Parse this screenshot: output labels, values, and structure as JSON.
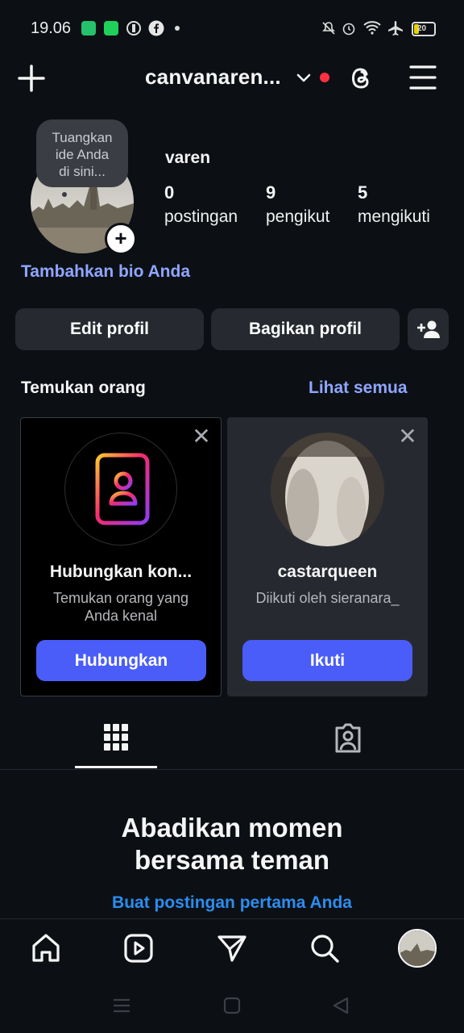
{
  "status_bar": {
    "time": "19.06",
    "battery": "20"
  },
  "header": {
    "title": "canvanaren...",
    "icons": [
      "plus-icon",
      "chevron-down-icon",
      "threads-icon",
      "menu-icon"
    ]
  },
  "profile": {
    "tooltip": [
      "Tuangkan",
      "ide Anda",
      "di sini..."
    ],
    "display_name": "varen",
    "stats": [
      {
        "value": "0",
        "label": "postingan"
      },
      {
        "value": "9",
        "label": "pengikut"
      },
      {
        "value": "5",
        "label": "mengikuti"
      }
    ],
    "bio_link": "Tambahkan bio Anda"
  },
  "actions": {
    "edit_label": "Edit profil",
    "share_label": "Bagikan profil"
  },
  "discover": {
    "title": "Temukan orang",
    "see_all": "Lihat semua",
    "cards": [
      {
        "title": "Hubungkan kon...",
        "subtitle_line1": "Temukan orang yang",
        "subtitle_line2": "Anda kenal",
        "button": "Hubungkan"
      },
      {
        "title": "castarqueen",
        "subtitle_line1": "Diikuti oleh sieranara_",
        "button": "Ikuti"
      }
    ]
  },
  "empty_state": {
    "title_line1": "Abadikan momen",
    "title_line2": "bersama teman",
    "link": "Buat postingan pertama Anda"
  },
  "colors": {
    "background": "#0c1014",
    "accent_blue": "#4a5df9",
    "link_blue": "#8fa6ff",
    "button_gray": "#262a30"
  }
}
